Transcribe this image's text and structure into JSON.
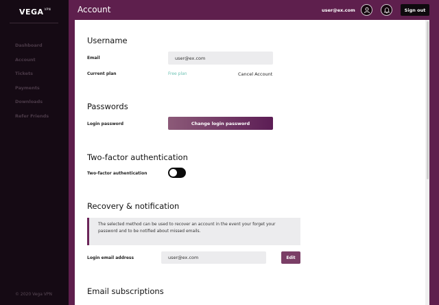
{
  "sidebar": {
    "logo": "VEGA",
    "logo_mark": "VPN",
    "nav": [
      "Dashboard",
      "Account",
      "Tickets",
      "Payments",
      "Downloads",
      "Refer Friends"
    ],
    "copyright": "© 2020 Vega VPN"
  },
  "header": {
    "title": "Account",
    "user_email": "user@ex.com",
    "sign_out": "Sign out"
  },
  "username_section": {
    "title": "Username",
    "email_label": "Email",
    "email_value": "user@ex.com",
    "plan_label": "Current plan",
    "plan_value": "Free plan",
    "cancel_link": "Cancel Account"
  },
  "passwords_section": {
    "title": "Passwords",
    "login_password_label": "Login password",
    "change_button": "Change login password"
  },
  "twofa_section": {
    "title": "Two-factor authentication",
    "label": "Two-factor authentication",
    "enabled": false
  },
  "recovery_section": {
    "title": "Recovery & notification",
    "notice_line1": "The selected method can be used to recover an account in the event your forget your",
    "notice_line2": "password and to be notified about missed emails.",
    "login_email_label": "Login email address",
    "login_email_value": "user@ex.com",
    "edit_button": "Edit"
  },
  "subscriptions_section": {
    "title": "Email subscriptions"
  },
  "colors": {
    "accent": "#5e1f4d",
    "sidebar_bg": "#150a14",
    "link_green": "#6cc2b3"
  }
}
